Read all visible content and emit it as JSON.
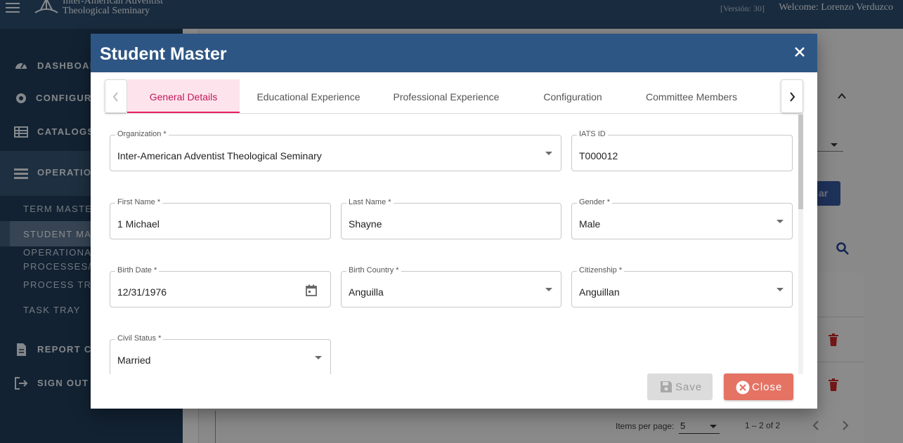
{
  "topbar": {
    "org_line1": "Inter-American Adventist",
    "org_line2": "Theological Seminary",
    "version": "[Versión: 30]",
    "welcome": "Welcome: Lorenzo Verduzco"
  },
  "sidebar": {
    "items": [
      {
        "label": "DASHBOARD",
        "icon": "gauge-icon"
      },
      {
        "label": "CONFIGURA",
        "icon": "gear-icon"
      },
      {
        "label": "CATALOGS",
        "icon": "table-icon"
      },
      {
        "label": "OPERATION",
        "icon": "operations-icon"
      },
      {
        "label": "REPORT CE",
        "icon": "document-icon"
      },
      {
        "label": "SIGN OUT",
        "icon": "sign-out-icon"
      }
    ],
    "sub_items": [
      {
        "label": "TERM MASTER"
      },
      {
        "label": "STUDENT MAS"
      },
      {
        "label": "OPERATIONAL"
      },
      {
        "label": "PROCESSES/F"
      },
      {
        "label": "PROCESS TRA"
      },
      {
        "label": "TASK TRAY"
      }
    ]
  },
  "background": {
    "button_fragment": "ar",
    "items_per_page_label": "Items per page:",
    "items_per_page_value": "5",
    "range_label": "1 – 2 of 2"
  },
  "dialog": {
    "title": "Student Master",
    "tabs": [
      {
        "label": "General Details",
        "active": true
      },
      {
        "label": "Educational Experience",
        "active": false
      },
      {
        "label": "Professional Experience",
        "active": false
      },
      {
        "label": "Configuration",
        "active": false
      },
      {
        "label": "Committee Members",
        "active": false
      }
    ],
    "fields": {
      "organization": {
        "label": "Organization *",
        "value": "Inter-American Adventist Theological Seminary"
      },
      "iats_id": {
        "label": "IATS ID",
        "value": "T000012"
      },
      "first_name": {
        "label": "First Name *",
        "value": "1 Michael"
      },
      "last_name": {
        "label": "Last Name *",
        "value": "Shayne"
      },
      "gender": {
        "label": "Gender *",
        "value": "Male"
      },
      "birth_date": {
        "label": "Birth Date *",
        "value": "12/31/1976"
      },
      "birth_country": {
        "label": "Birth Country *",
        "value": "Anguilla"
      },
      "citizenship": {
        "label": "Citizenship *",
        "value": "Anguillan"
      },
      "civil_status": {
        "label": "Civil Status *",
        "value": "Married"
      }
    },
    "save_label": "Save",
    "close_label": "Close"
  },
  "colors": {
    "header": "#2e5684",
    "sidebar": "#1f3b57",
    "active_tab": "#e91e63",
    "close_button": "#e57364"
  }
}
